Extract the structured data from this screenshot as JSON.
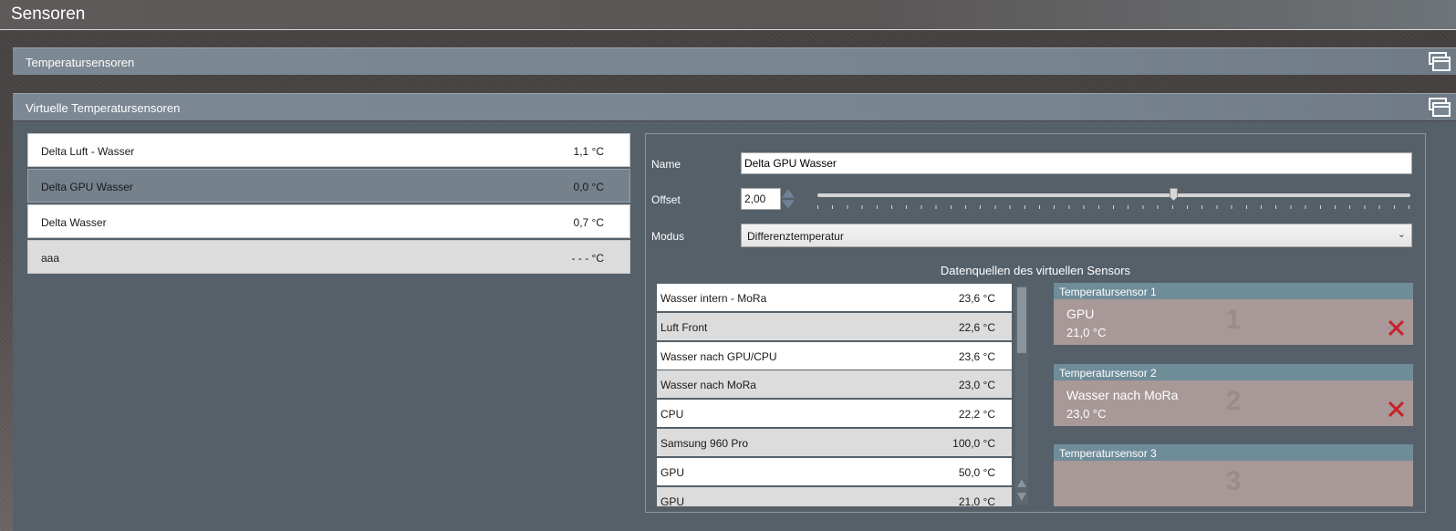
{
  "window": {
    "title": "Sensoren"
  },
  "sections": {
    "temperature": {
      "label": "Temperatursensoren"
    },
    "virtual": {
      "label": "Virtuelle Temperatursensoren"
    }
  },
  "virtual_sensors": [
    {
      "name": "Delta Luft - Wasser",
      "value": "1,1 °C"
    },
    {
      "name": "Delta GPU Wasser",
      "value": "0,0 °C",
      "selected": true
    },
    {
      "name": "Delta Wasser",
      "value": "0,7 °C"
    },
    {
      "name": "aaa",
      "value": "- - - °C"
    }
  ],
  "editor": {
    "name_label": "Name",
    "name_value": "Delta GPU Wasser",
    "offset_label": "Offset",
    "offset_value": "2,00",
    "offset_slider_fraction": 0.6,
    "mode_label": "Modus",
    "mode_value": "Differenztemperatur",
    "sources_title": "Datenquellen des virtuellen Sensors"
  },
  "sources": [
    {
      "name": "Wasser intern - MoRa",
      "value": "23,6 °C"
    },
    {
      "name": "Luft Front",
      "value": "22,6 °C"
    },
    {
      "name": "Wasser nach GPU/CPU",
      "value": "23,6 °C"
    },
    {
      "name": "Wasser nach MoRa",
      "value": "23,0 °C"
    },
    {
      "name": "CPU",
      "value": "22,2 °C"
    },
    {
      "name": "Samsung 960 Pro",
      "value": "100,0 °C"
    },
    {
      "name": "GPU",
      "value": "50,0 °C"
    },
    {
      "name": "GPU",
      "value": "21,0 °C"
    }
  ],
  "slots": [
    {
      "header": "Temperatursensor 1",
      "number": "1",
      "sensor_name": "GPU",
      "sensor_value": "21,0 °C"
    },
    {
      "header": "Temperatursensor 2",
      "number": "2",
      "sensor_name": "Wasser nach MoRa",
      "sensor_value": "23,0 °C"
    },
    {
      "header": "Temperatursensor 3",
      "number": "3",
      "sensor_name": "",
      "sensor_value": ""
    }
  ],
  "icons": {
    "collapse": "collapse-windows-icon",
    "remove": "remove-x-icon",
    "spin_up": "arrow-up-icon",
    "spin_down": "arrow-down-icon",
    "dropdown": "chevron-down-icon"
  },
  "colors": {
    "panel": "#556069",
    "section_bar": "#7c8893",
    "slot_header": "#6f8c99",
    "slot_body": "#a89898",
    "remove": "#c8202a"
  }
}
